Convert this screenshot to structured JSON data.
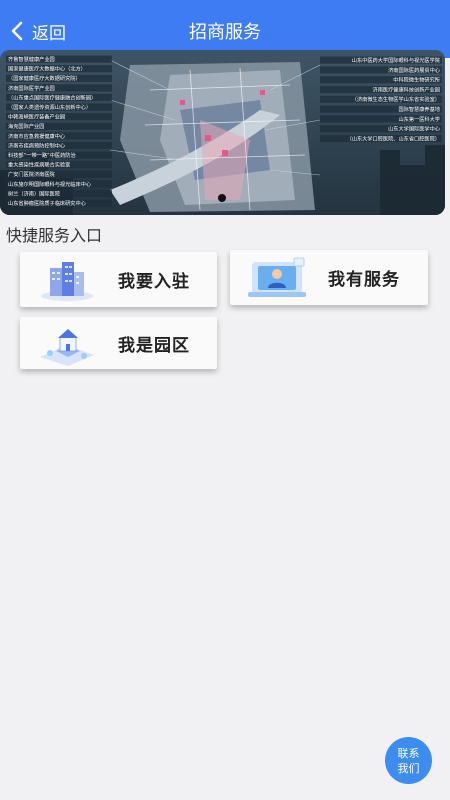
{
  "header": {
    "back_label": "返回",
    "title": "招商服务"
  },
  "banner": {
    "left_labels": [
      "齐鲁智慧健康产业园",
      "国家健康医疗大数据中心（北方）",
      "（国家健康医疗大数据研究院）",
      "济南国际医学产业园",
      "（山东重点国际医疗健康融合创新园）",
      "（国家人类遗传资源山东创新中心）",
      "中韩海峡医疗装备产业园",
      "海克国际产业园",
      "济南市应急救援健康中心",
      "济南市疾病预防控制中心",
      "科技部“一带一路”中医药防治",
      "重大感染性疾病联合实验室",
      "广安门医院济南医院",
      "山东施尔明国际眼科与视光临床中心",
      "树兰（济南）国际医院",
      "山东省肿瘤医院质子临床研究中心"
    ],
    "right_labels": [
      "山东中医药大学国际眼科与视光医学院",
      "济南国际医药展贸中心",
      "中科院微生物研究所",
      "济南医疗健康科技创新产业园",
      "（济南微生态生物医学山东省实验室）",
      "国际智慧康养基地",
      "山东第一医科大学",
      "山东大学国际医学中心",
      "（山东大学口腔医院、山东省口腔医院）"
    ]
  },
  "section_title": "快捷服务入口",
  "quick_entries": [
    {
      "label": "我要入驻",
      "icon": "buildings-icon"
    },
    {
      "label": "我有服务",
      "icon": "service-person-icon"
    },
    {
      "label": "我是园区",
      "icon": "park-house-icon"
    }
  ],
  "contact": {
    "line1": "联系",
    "line2": "我们"
  },
  "colors": {
    "header_bg": "#3d7cf2",
    "page_bg": "#f1f1f4",
    "contact_bg": "#3d8cf0"
  }
}
